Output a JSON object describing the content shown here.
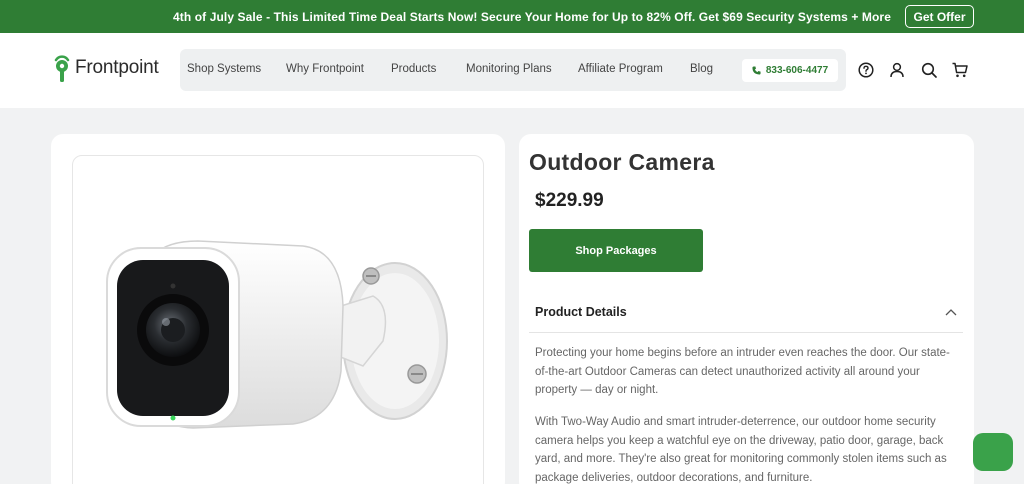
{
  "promo": {
    "text": "4th of July Sale - This Limited Time Deal Starts Now! Secure Your Home for Up to 82% Off. Get $69 Security Systems + More",
    "button": "Get Offer"
  },
  "header": {
    "logo_text": "Frontpoint",
    "nav": [
      "Shop Systems",
      "Why Frontpoint",
      "Products",
      "Monitoring Plans",
      "Affiliate Program",
      "Blog"
    ],
    "phone": "833-606-4477"
  },
  "product": {
    "title": "Outdoor Camera",
    "price": "$229.99",
    "cta": "Shop Packages",
    "details_heading": "Product Details",
    "description": [
      "Protecting your home begins before an intruder even reaches the door. Our state-of-the-art Outdoor Cameras can detect unauthorized activity all around your property — day or night.",
      "With Two-Way Audio and smart intruder-deterrence, our outdoor home security camera helps you keep a watchful eye on the driveway, patio door, garage, back yard, and more. They're also great for monitoring commonly stolen items such as package deliveries, outdoor decorations, and furniture."
    ]
  },
  "colors": {
    "brand_green": "#2f7d34",
    "chat_green": "#3aa24a",
    "page_bg": "#f1f2f3"
  },
  "icons": [
    "phone-icon",
    "help-icon",
    "account-icon",
    "search-icon",
    "cart-icon",
    "chevron-up-icon",
    "chat-icon"
  ]
}
